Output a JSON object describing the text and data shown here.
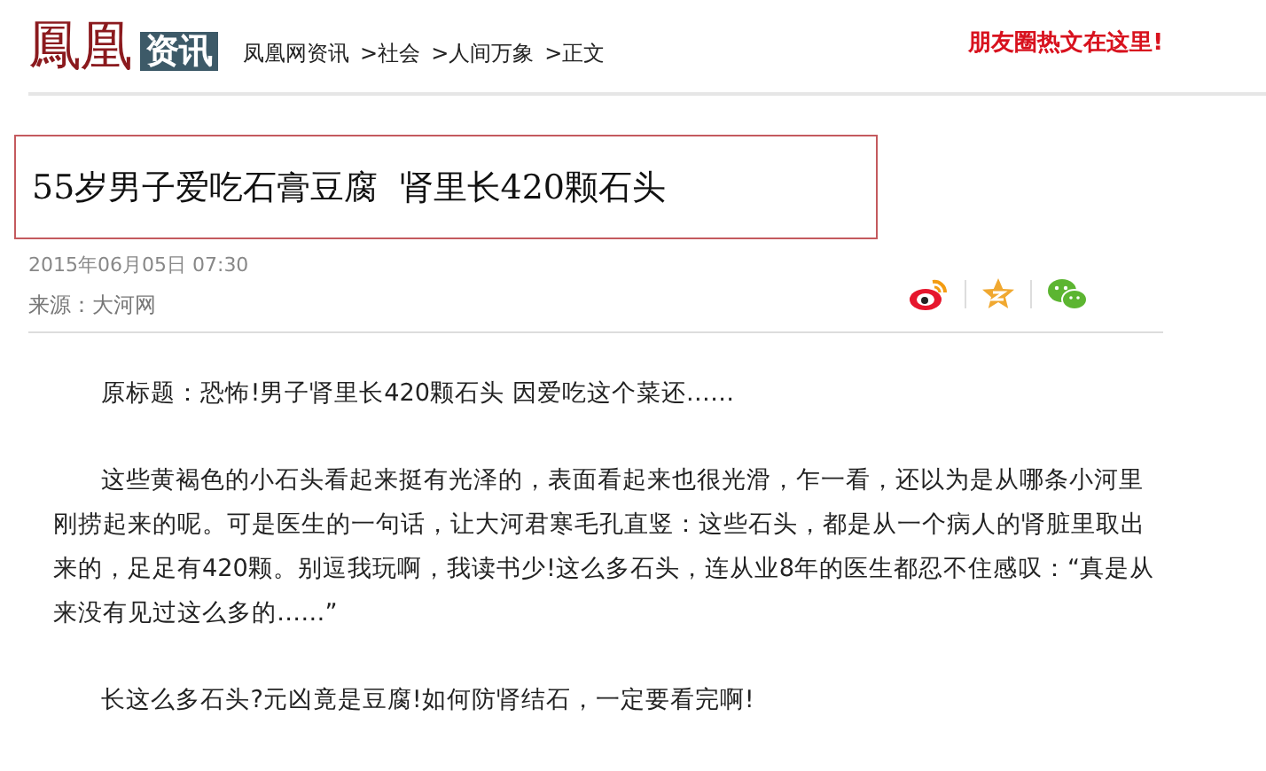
{
  "header": {
    "logo": "鳳凰",
    "channel": "资讯",
    "breadcrumb": [
      "凤凰网资讯",
      ">社会",
      ">人间万象",
      ">正文"
    ],
    "promo": "朋友圈热文在这里!"
  },
  "article": {
    "title": "55岁男子爱吃石膏豆腐  肾里长420颗石头",
    "date": "2015年06月05日  07:30",
    "source": "来源：大河网",
    "share": [
      {
        "kind": "weibo"
      },
      {
        "kind": "qzone"
      },
      {
        "kind": "wechat"
      }
    ],
    "paragraphs": [
      "原标题：恐怖!男子肾里长420颗石头 因爱吃这个菜还……",
      "这些黄褐色的小石头看起来挺有光泽的，表面看起来也很光滑，乍一看，还以为是从哪条小河里刚捞起来的呢。可是医生的一句话，让大河君寒毛孔直竖：这些石头，都是从一个病人的肾脏里取出来的，足足有420颗。别逗我玩啊，我读书少!这么多石头，连从业8年的医生都忍不住感叹：“真是从来没有见过这么多的……”",
      "长这么多石头?元凶竟是豆腐!如何防肾结石，一定要看完啊!"
    ]
  }
}
